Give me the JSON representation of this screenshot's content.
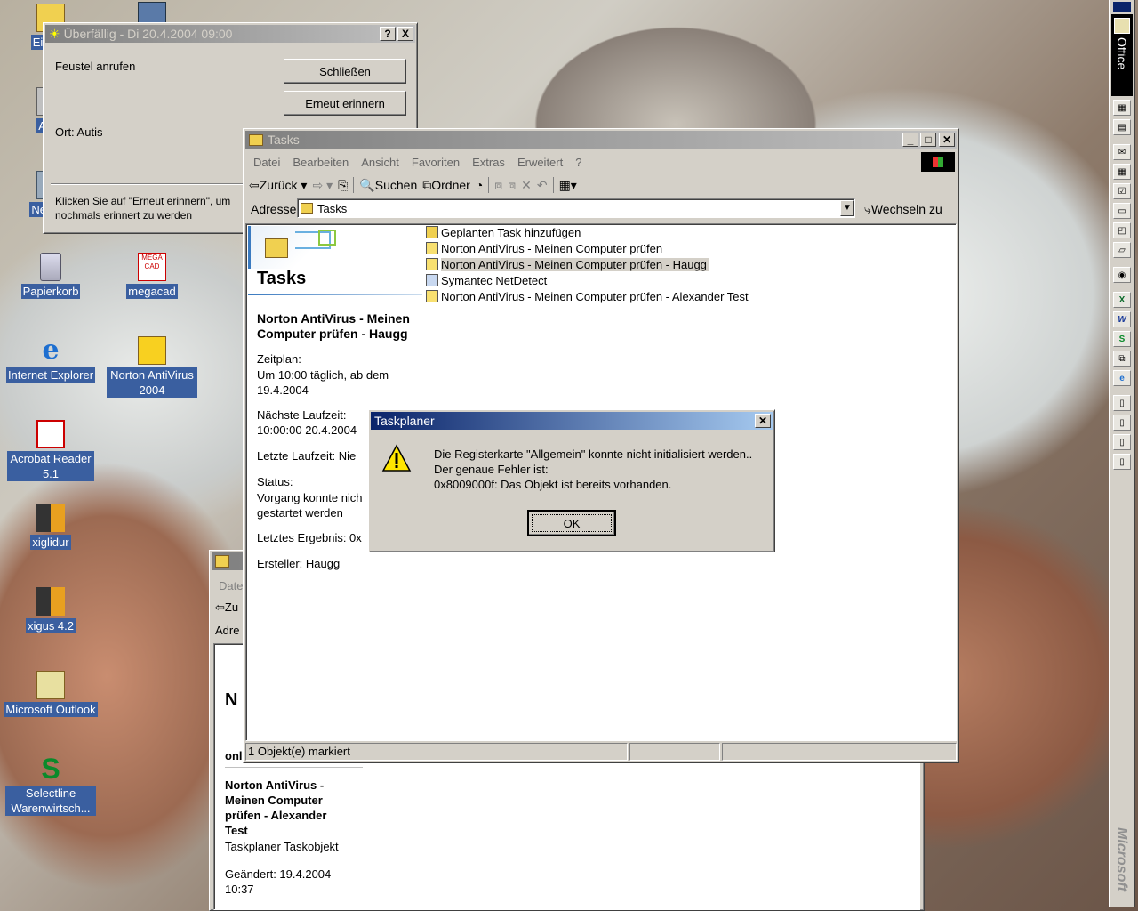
{
  "desktop": {
    "icons_left": [
      {
        "label": "Eigene"
      },
      {
        "label": "Arbe"
      },
      {
        "label": "Netzwe"
      },
      {
        "label": "Papierkorb"
      },
      {
        "label": "Internet Explorer"
      },
      {
        "label": "Acrobat Reader 5.1"
      },
      {
        "label": "xiglidur"
      },
      {
        "label": "xigus 4.2"
      },
      {
        "label": "Microsoft Outlook"
      },
      {
        "label": "Selectline Warenwirtsch..."
      }
    ],
    "icons_right": [
      {
        "label": "megacad"
      },
      {
        "label": "Norton AntiVirus 2004"
      }
    ]
  },
  "reminder": {
    "title": "Überfällig - Di 20.4.2004 09:00",
    "subject": "Feustel anrufen",
    "location": "Ort: Autis",
    "close_button": "Schließen",
    "snooze_button": "Erneut erinnern",
    "hint": "Klicken Sie auf \"Erneut erinnern\", um nochmals erinnert zu werden",
    "help_button": "?",
    "x_button": "X"
  },
  "tasks_window": {
    "title": "Tasks",
    "menu": [
      "Datei",
      "Bearbeiten",
      "Ansicht",
      "Favoriten",
      "Extras",
      "Erweitert",
      "?"
    ],
    "toolbar": {
      "back": "Zurück",
      "search": "Suchen",
      "folders": "Ordner"
    },
    "address_label": "Adresse",
    "address_value": "Tasks",
    "go_label": "Wechseln zu",
    "panel_title": "Tasks",
    "files": [
      {
        "name": "Geplanten Task hinzufügen",
        "selected": false
      },
      {
        "name": "Norton AntiVirus - Meinen Computer prüfen",
        "selected": false
      },
      {
        "name": "Norton AntiVirus - Meinen Computer prüfen - Haugg",
        "selected": true
      },
      {
        "name": "Symantec NetDetect",
        "selected": false
      },
      {
        "name": "Norton AntiVirus - Meinen Computer prüfen - Alexander Test",
        "selected": false
      }
    ],
    "details": {
      "name": "Norton AntiVirus - Meinen Computer prüfen - Haugg",
      "schedule_label": "Zeitplan:",
      "schedule_value": "Um 10:00 täglich, ab dem 19.4.2004",
      "next_run_label": "Nächste Laufzeit:",
      "next_run_value": "10:00:00 20.4.2004",
      "last_run": "Letzte Laufzeit: Nie",
      "status_label": "Status:",
      "status_value": "Vorgang konnte nich gestartet werden",
      "last_result": "Letztes Ergebnis: 0x",
      "creator": "Ersteller: Haugg"
    },
    "status_bar": "1 Objekt(e) markiert"
  },
  "back_window": {
    "menu_fragment": "Date",
    "back_fragment": "Zu",
    "address_fragment": "Adre",
    "panel_fragment": "N",
    "item_fragment": "onl",
    "details_name": "Norton AntiVirus - Meinen Computer prüfen - Alexander Test",
    "details_type": "Taskplaner Taskobjekt",
    "modified": "Geändert: 19.4.2004 10:37"
  },
  "dialog": {
    "title": "Taskplaner",
    "line1": "Die Registerkarte \"Allgemein\" konnte nicht initialisiert werden..",
    "line2": "Der genaue Fehler ist:",
    "line3": "0x8009000f: Das Objekt ist bereits vorhanden.",
    "ok_button": "OK"
  },
  "office_bar": {
    "label": "Office",
    "footer": "Microsoft"
  }
}
